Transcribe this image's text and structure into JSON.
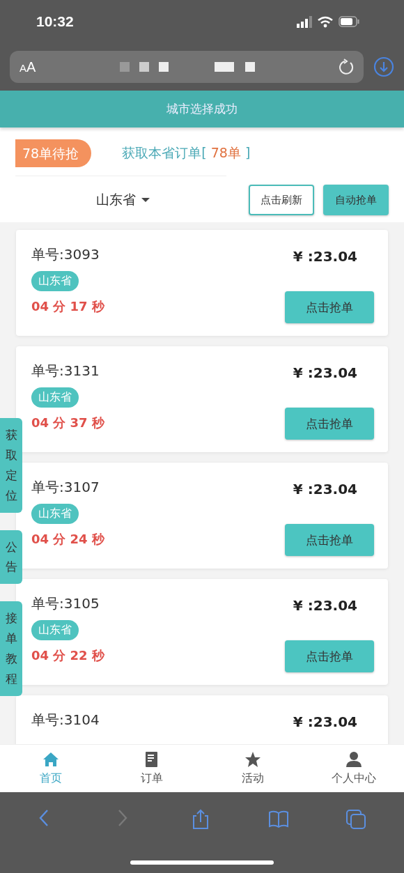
{
  "status_bar": {
    "time": "10:32"
  },
  "address_bar": {
    "text_size_button": "AA"
  },
  "toast": "城市选择成功",
  "header": {
    "pending_badge": "78单待抢",
    "fetch_link": {
      "label": "获取本省订单[",
      "count": "78单",
      "end": "]"
    }
  },
  "filter": {
    "province": "山东省",
    "buttons": [
      {
        "label": "点击刷新",
        "kind": "outline"
      },
      {
        "label": "自动抢单",
        "kind": "filled"
      }
    ]
  },
  "orders": [
    {
      "number": "单号:3093",
      "price": "¥ :23.04",
      "province": "山东省",
      "countdown": "04 分 17 秒",
      "button": "点击抢单"
    },
    {
      "number": "单号:3131",
      "price": "¥ :23.04",
      "province": "山东省",
      "countdown": "04 分 37 秒",
      "button": "点击抢单"
    },
    {
      "number": "单号:3107",
      "price": "¥ :23.04",
      "province": "山东省",
      "countdown": "04 分 24 秒",
      "button": "点击抢单"
    },
    {
      "number": "单号:3105",
      "price": "¥ :23.04",
      "province": "山东省",
      "countdown": "04 分 22 秒",
      "button": "点击抢单"
    },
    {
      "number": "单号:3104",
      "price": "¥ :23.04"
    }
  ],
  "side_tabs": [
    "获取定位",
    "公告",
    "接单教程"
  ],
  "bottom_nav": [
    {
      "label": "首页",
      "kind": "home",
      "selected": true
    },
    {
      "label": "订单",
      "kind": "document",
      "selected": false
    },
    {
      "label": "活动",
      "kind": "star",
      "selected": false
    },
    {
      "label": "个人中心",
      "kind": "person",
      "selected": false
    }
  ],
  "browser_toolbar": [
    {
      "kind": "back",
      "disabled": false
    },
    {
      "kind": "forward",
      "disabled": true
    },
    {
      "kind": "share",
      "disabled": false
    },
    {
      "kind": "book",
      "disabled": false
    },
    {
      "kind": "tabs",
      "disabled": false
    }
  ]
}
